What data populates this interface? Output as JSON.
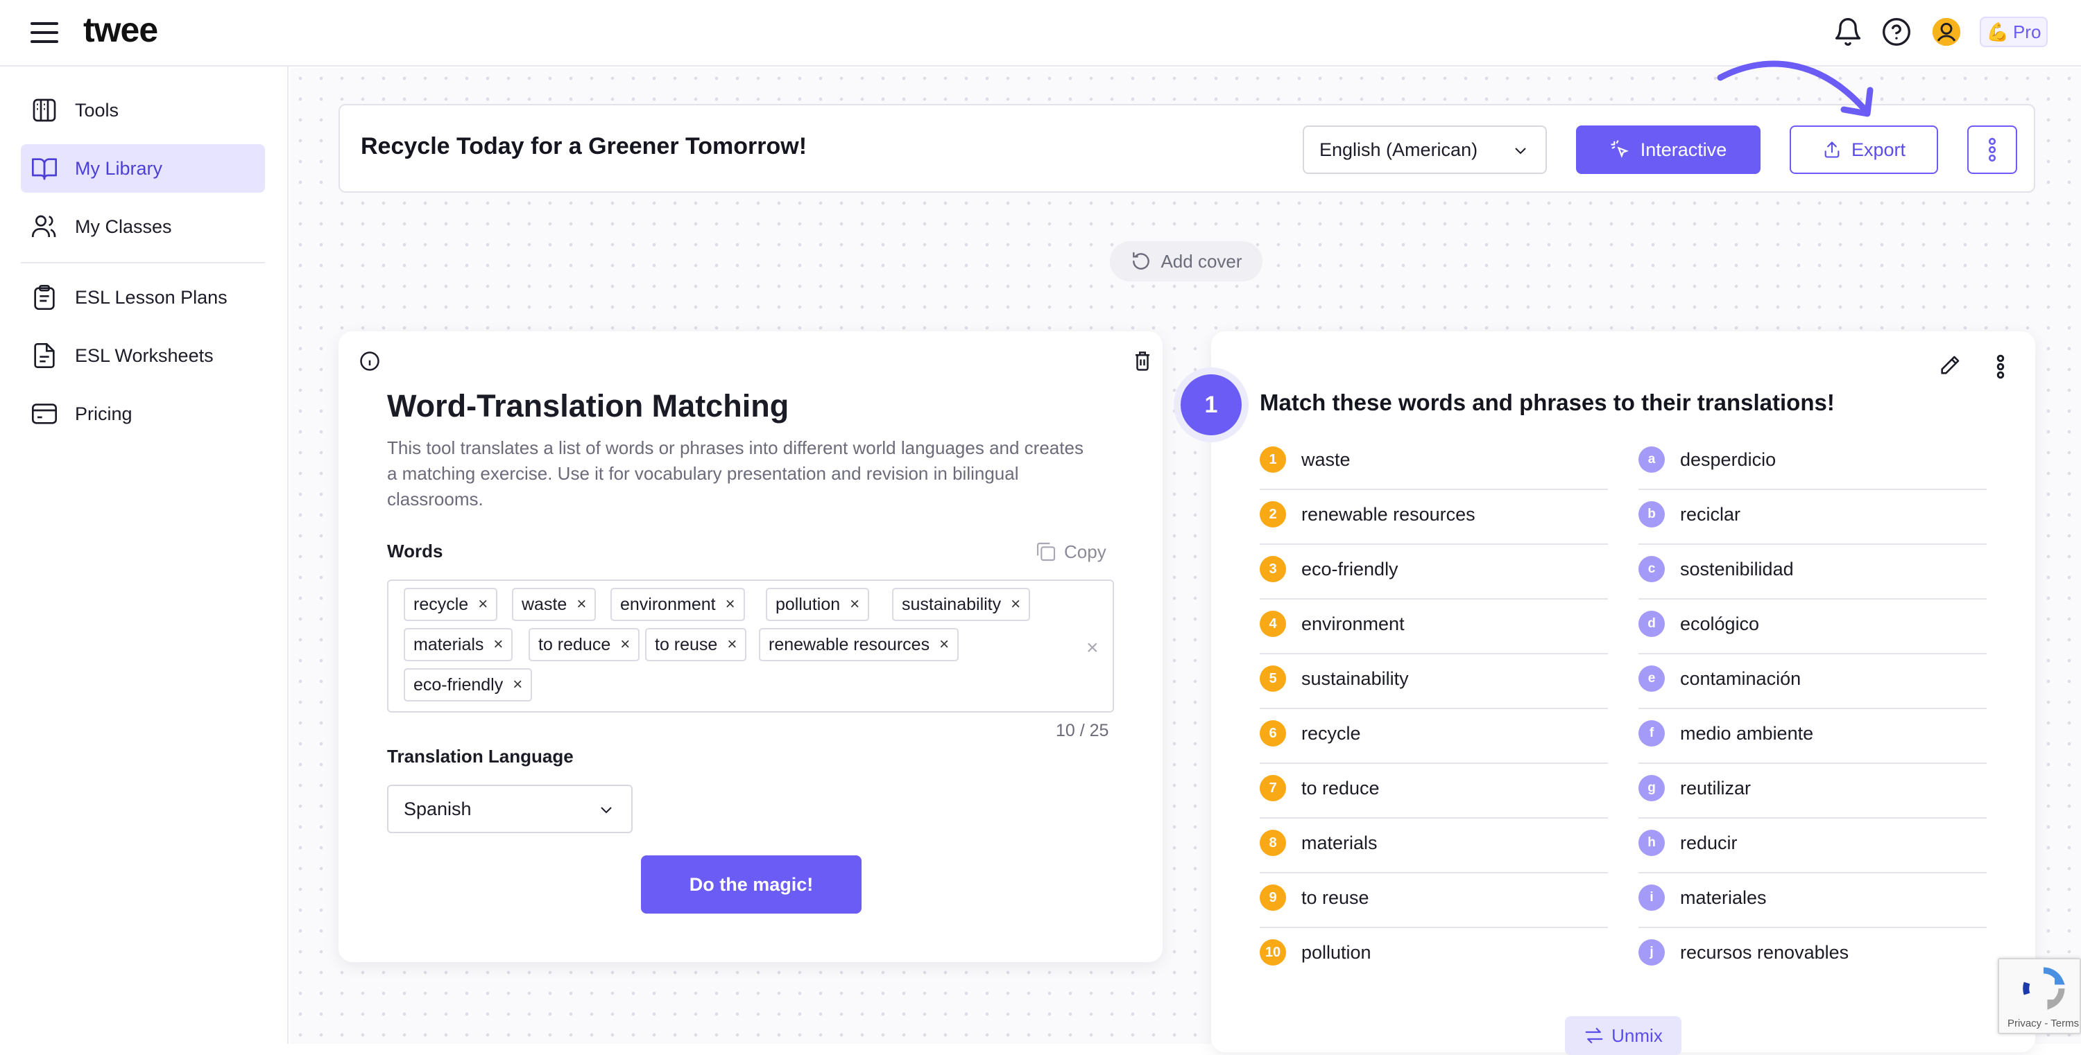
{
  "app": {
    "logo": "twee",
    "pro_label": "Pro",
    "pro_emoji": "💪"
  },
  "sidebar": {
    "items": [
      {
        "label": "Tools",
        "icon": "tools-icon"
      },
      {
        "label": "My Library",
        "icon": "book-icon",
        "active": true
      },
      {
        "label": "My Classes",
        "icon": "users-icon"
      },
      {
        "label": "ESL Lesson Plans",
        "icon": "clipboard-icon"
      },
      {
        "label": "ESL Worksheets",
        "icon": "worksheet-icon"
      },
      {
        "label": "Pricing",
        "icon": "card-icon"
      }
    ]
  },
  "header": {
    "title": "Recycle Today for a Greener Tomorrow!",
    "language": "English (American)",
    "interactive_label": "Interactive",
    "export_label": "Export"
  },
  "cover": {
    "label": "Add cover"
  },
  "tool": {
    "title": "Word-Translation Matching",
    "description": "This tool translates a list of words or phrases into different world languages and creates a matching exercise. Use it for vocabulary presentation and revision in bilingual classrooms.",
    "words_label": "Words",
    "copy_label": "Copy",
    "words": [
      "recycle",
      "waste",
      "environment",
      "pollution",
      "sustainability",
      "materials",
      "to reduce",
      "to reuse",
      "renewable resources",
      "eco-friendly"
    ],
    "chip_remove": "×",
    "clear_all": "×",
    "counter": "10 / 25",
    "translation_label": "Translation Language",
    "translation_value": "Spanish",
    "submit_label": "Do the magic!"
  },
  "result": {
    "step": "1",
    "title": "Match these words and phrases to their translations!",
    "left": [
      {
        "n": "1",
        "text": "waste"
      },
      {
        "n": "2",
        "text": "renewable resources"
      },
      {
        "n": "3",
        "text": "eco-friendly"
      },
      {
        "n": "4",
        "text": "environment"
      },
      {
        "n": "5",
        "text": "sustainability"
      },
      {
        "n": "6",
        "text": "recycle"
      },
      {
        "n": "7",
        "text": "to reduce"
      },
      {
        "n": "8",
        "text": "materials"
      },
      {
        "n": "9",
        "text": "to reuse"
      },
      {
        "n": "10",
        "text": "pollution"
      }
    ],
    "right": [
      {
        "n": "a",
        "text": "desperdicio"
      },
      {
        "n": "b",
        "text": "reciclar"
      },
      {
        "n": "c",
        "text": "sostenibilidad"
      },
      {
        "n": "d",
        "text": "ecológico"
      },
      {
        "n": "e",
        "text": "contaminación"
      },
      {
        "n": "f",
        "text": "medio ambiente"
      },
      {
        "n": "g",
        "text": "reutilizar"
      },
      {
        "n": "h",
        "text": "reducir"
      },
      {
        "n": "i",
        "text": "materiales"
      },
      {
        "n": "j",
        "text": "recursos renovables"
      }
    ],
    "unmix_label": "Unmix"
  },
  "recaptcha": {
    "text": "Privacy - Terms"
  },
  "colors": {
    "accent": "#6a5cf5",
    "number_badge": "#f8a915",
    "letter_badge": "#a49af8",
    "active_bg": "#e7e4ff"
  }
}
